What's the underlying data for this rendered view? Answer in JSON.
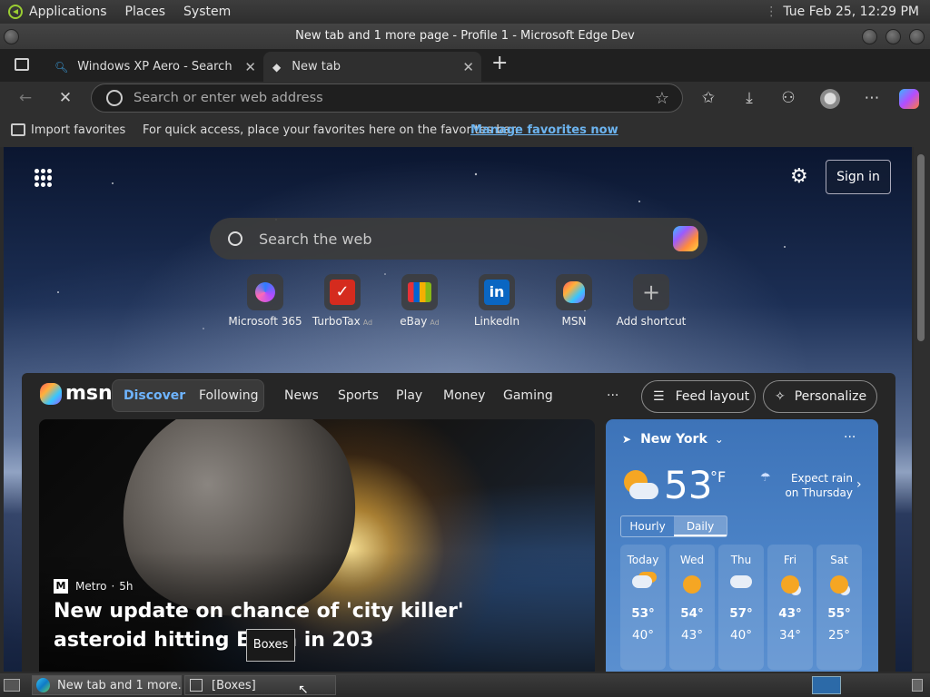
{
  "gnome_panel": {
    "menus": [
      "Applications",
      "Places",
      "System"
    ],
    "clock": "Tue Feb 25, 12:29 PM"
  },
  "window": {
    "title": "New tab and 1 more page - Profile 1 - Microsoft Edge Dev"
  },
  "tabs": [
    {
      "label": "Windows XP Aero - Search",
      "active": false
    },
    {
      "label": "New tab",
      "active": true
    }
  ],
  "omnibox": {
    "placeholder": "Search or enter web address"
  },
  "favorites_bar": {
    "import_label": "Import favorites",
    "hint": "For quick access, place your favorites here on the favorites bar.",
    "manage_link": "Manage favorites now"
  },
  "newtab": {
    "sign_in": "Sign in",
    "search_placeholder": "Search the web",
    "shortcuts": [
      {
        "label": "Microsoft 365",
        "ad": ""
      },
      {
        "label": "TurboTax",
        "ad": "Ad"
      },
      {
        "label": "eBay",
        "ad": "Ad"
      },
      {
        "label": "LinkedIn",
        "ad": ""
      },
      {
        "label": "MSN",
        "ad": ""
      },
      {
        "label": "Add shortcut",
        "ad": ""
      }
    ]
  },
  "msn": {
    "brand": "msn",
    "tabs": [
      "Discover",
      "Following"
    ],
    "links": [
      "News",
      "Sports",
      "Play",
      "Money",
      "Gaming"
    ],
    "more": "···",
    "feed_layout": "Feed layout",
    "personalize": "Personalize",
    "hero": {
      "source": "Metro",
      "age": "5h",
      "headline": "New update on chance of 'city killer' asteroid hitting Earth in 203"
    },
    "tooltip": "Boxes",
    "weather": {
      "location": "New York",
      "temp": "53",
      "unit": "°F",
      "forecast_note": "Expect rain on Thursday",
      "toggle": [
        "Hourly",
        "Daily"
      ],
      "days": [
        {
          "name": "Today",
          "hi": "53°",
          "lo": "40°",
          "icon": "cloud-sun-rain-icon"
        },
        {
          "name": "Wed",
          "hi": "54°",
          "lo": "43°",
          "icon": "sun-icon"
        },
        {
          "name": "Thu",
          "hi": "57°",
          "lo": "40°",
          "icon": "rain-cloud-icon"
        },
        {
          "name": "Fri",
          "hi": "43°",
          "lo": "34°",
          "icon": "partly-sunny-icon"
        },
        {
          "name": "Sat",
          "hi": "55°",
          "lo": "25°",
          "icon": "partly-sunny-icon"
        }
      ]
    }
  },
  "taskbar": {
    "items": [
      "New tab and 1 more...",
      "[Boxes]"
    ]
  }
}
